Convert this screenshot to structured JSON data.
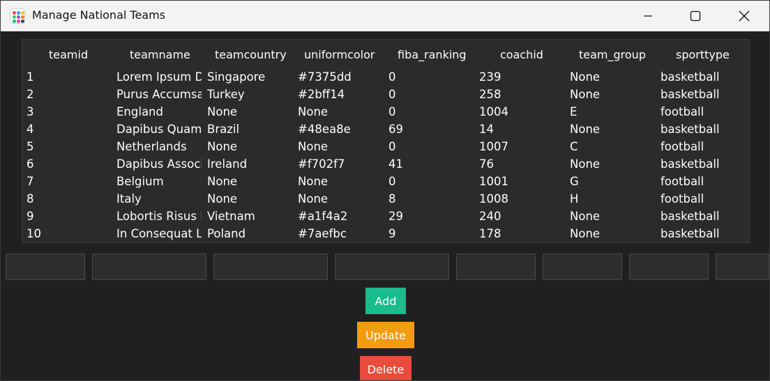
{
  "window": {
    "title": "Manage National Teams",
    "controls": {
      "minimize": "minimize-icon",
      "maximize": "maximize-icon",
      "close": "close-icon"
    }
  },
  "table": {
    "columns": [
      "teamid",
      "teamname",
      "teamcountry",
      "uniformcolor",
      "fiba_ranking",
      "coachid",
      "team_group",
      "sporttype"
    ],
    "rows": [
      [
        "1",
        "Lorem Ipsum D",
        "Singapore",
        "#7375dd",
        "0",
        "239",
        "None",
        "basketball"
      ],
      [
        "2",
        "Purus Accumsan",
        "Turkey",
        "#2bff14",
        "0",
        "258",
        "None",
        "basketball"
      ],
      [
        "3",
        "England",
        "None",
        "None",
        "0",
        "1004",
        "E",
        "football"
      ],
      [
        "4",
        "Dapibus Quam",
        "Brazil",
        "#48ea8e",
        "69",
        "14",
        "None",
        "basketball"
      ],
      [
        "5",
        "Netherlands",
        "None",
        "None",
        "0",
        "1007",
        "C",
        "football"
      ],
      [
        "6",
        "Dapibus Associ",
        "Ireland",
        "#f702f7",
        "41",
        "76",
        "None",
        "basketball"
      ],
      [
        "7",
        "Belgium",
        "None",
        "None",
        "0",
        "1001",
        "G",
        "football"
      ],
      [
        "8",
        "Italy",
        "None",
        "None",
        "8",
        "1008",
        "H",
        "football"
      ],
      [
        "9",
        "Lobortis Risus I",
        "Vietnam",
        "#a1f4a2",
        "29",
        "240",
        "None",
        "basketball"
      ],
      [
        "10",
        "In Consequat LL",
        "Poland",
        "#7aefbc",
        "9",
        "178",
        "None",
        "basketball"
      ]
    ]
  },
  "inputs": [
    {
      "name": "teamid-input",
      "value": ""
    },
    {
      "name": "teamname-input",
      "value": ""
    },
    {
      "name": "teamcountry-input",
      "value": ""
    },
    {
      "name": "uniformcolor-input",
      "value": ""
    },
    {
      "name": "fiba-ranking-input",
      "value": ""
    },
    {
      "name": "coachid-input",
      "value": ""
    },
    {
      "name": "team-group-input",
      "value": ""
    },
    {
      "name": "sporttype-input",
      "value": ""
    }
  ],
  "buttons": {
    "add": {
      "label": "Add",
      "color": "#1abc8c"
    },
    "update": {
      "label": "Update",
      "color": "#f39c12"
    },
    "delete": {
      "label": "Delete",
      "color": "#e74c3c"
    }
  },
  "colors": {
    "background": "#202020",
    "table_background": "#2b2b2b",
    "titlebar": "#f3f3f3"
  }
}
